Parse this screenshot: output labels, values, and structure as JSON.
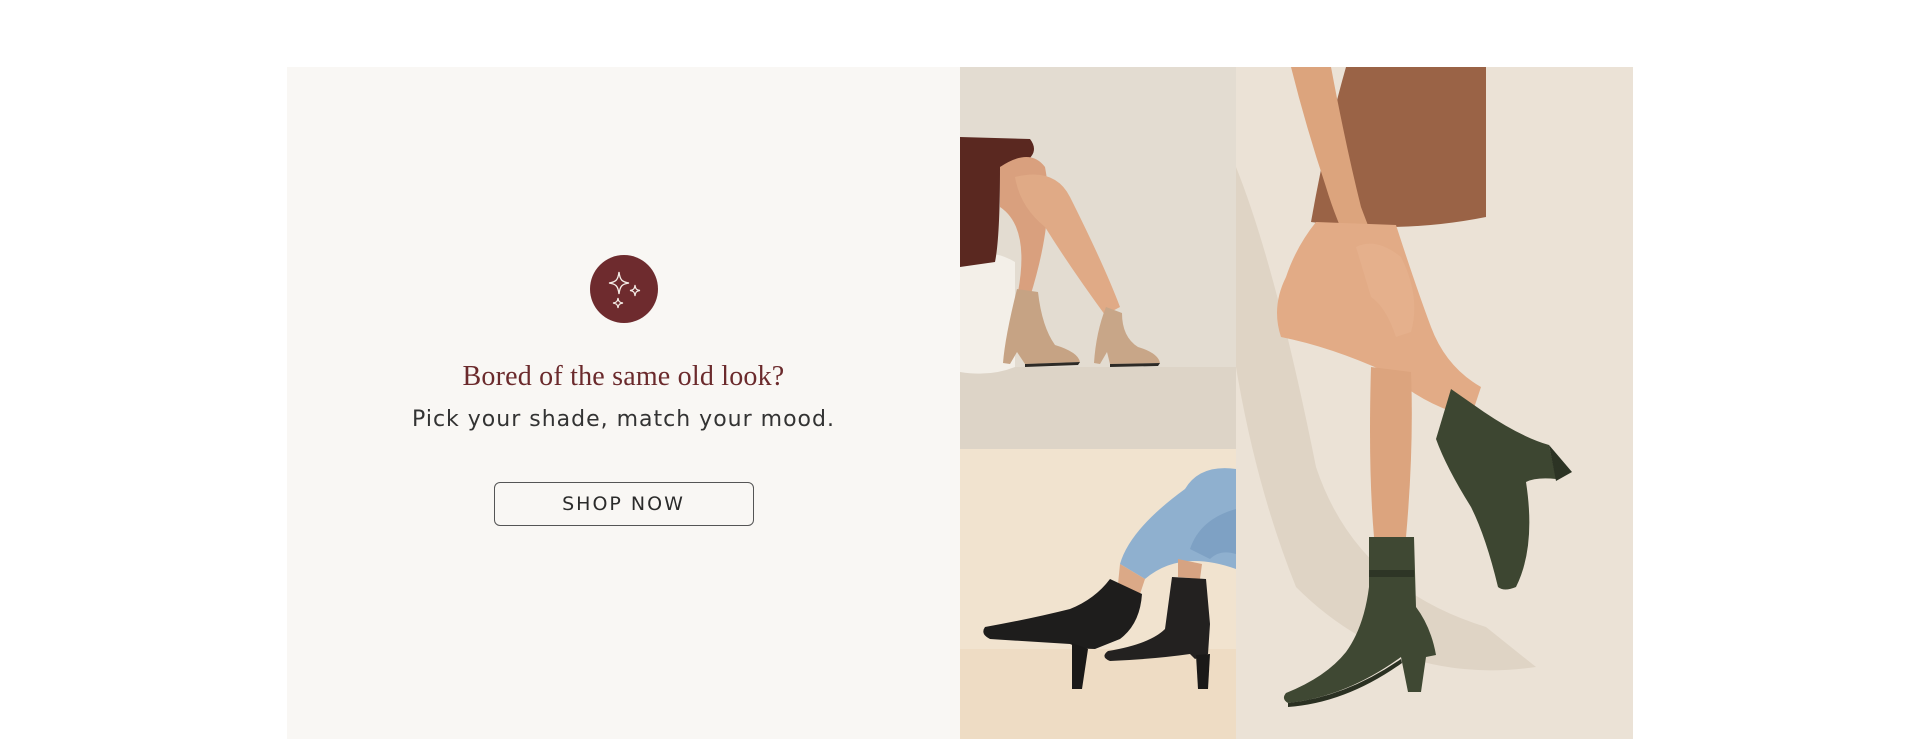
{
  "promo": {
    "icon": "sparkles-icon",
    "headline": "Bored of the same old look?",
    "subline": "Pick your shade, match your mood.",
    "cta_label": "SHOP NOW"
  },
  "colors": {
    "accent": "#6e2b2e",
    "panel_background": "#f9f7f4"
  },
  "images": [
    {
      "subject": "beige-ankle-boots-photo"
    },
    {
      "subject": "black-ankle-boots-photo"
    },
    {
      "subject": "olive-green-ankle-boots-photo"
    }
  ]
}
